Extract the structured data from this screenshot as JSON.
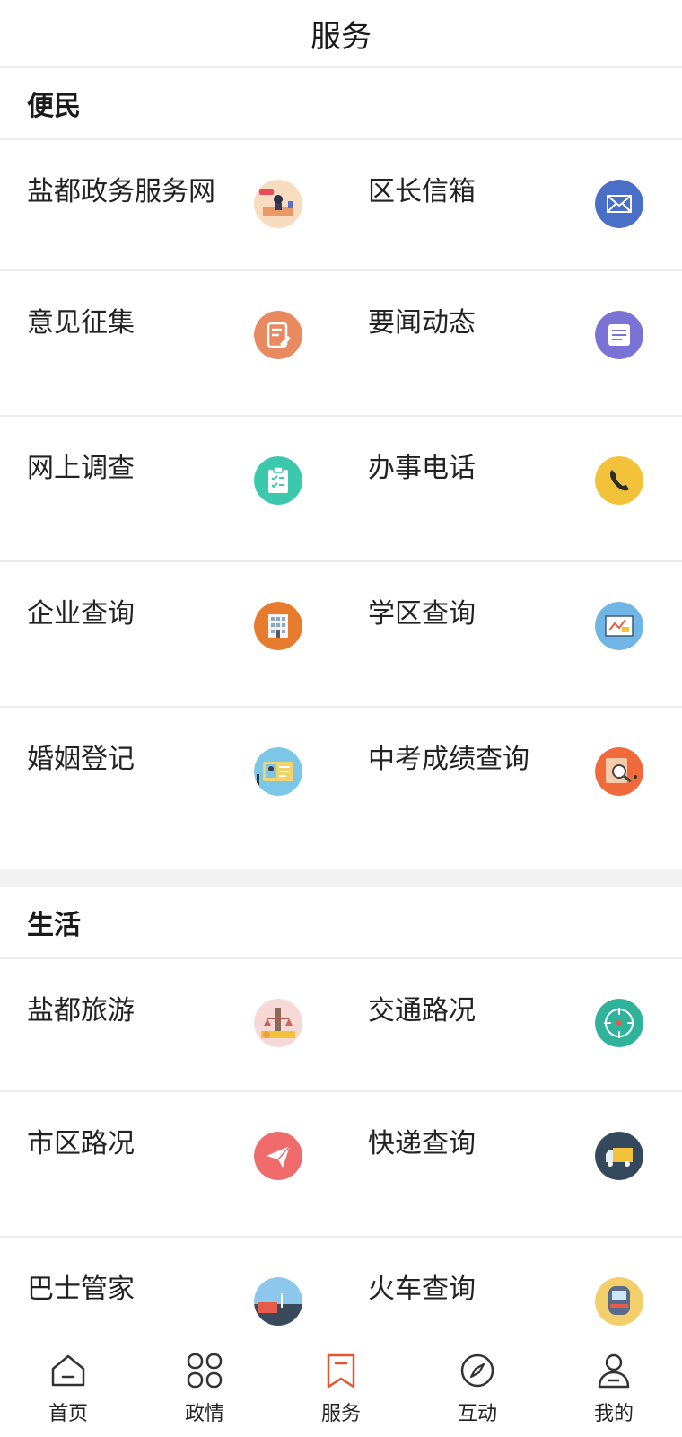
{
  "header": {
    "title": "服务"
  },
  "sections": [
    {
      "title": "便民",
      "rows": [
        [
          {
            "label": "盐都政务服务网",
            "icon": "service-desk-icon"
          },
          {
            "label": "区长信箱",
            "icon": "mail-icon"
          }
        ],
        [
          {
            "label": "意见征集",
            "icon": "edit-note-icon"
          },
          {
            "label": "要闻动态",
            "icon": "news-icon"
          }
        ],
        [
          {
            "label": "网上调查",
            "icon": "clipboard-check-icon"
          },
          {
            "label": "办事电话",
            "icon": "phone-icon"
          }
        ],
        [
          {
            "label": "企业查询",
            "icon": "building-icon"
          },
          {
            "label": "学区查询",
            "icon": "school-board-icon"
          }
        ],
        [
          {
            "label": "婚姻登记",
            "icon": "id-card-icon"
          },
          {
            "label": "中考成绩查询",
            "icon": "search-report-icon"
          }
        ]
      ]
    },
    {
      "title": "生活",
      "rows": [
        [
          {
            "label": "盐都旅游",
            "icon": "travel-icon"
          },
          {
            "label": "交通路况",
            "icon": "target-icon"
          }
        ],
        [
          {
            "label": "市区路况",
            "icon": "paper-plane-icon"
          },
          {
            "label": "快递查询",
            "icon": "truck-icon"
          }
        ],
        [
          {
            "label": "巴士管家",
            "icon": "bus-icon"
          },
          {
            "label": "火车查询",
            "icon": "train-icon"
          }
        ]
      ]
    }
  ],
  "tabbar": [
    {
      "label": "首页",
      "icon": "home-icon"
    },
    {
      "label": "政情",
      "icon": "apps-icon"
    },
    {
      "label": "服务",
      "icon": "bookmark-icon",
      "active": true
    },
    {
      "label": "互动",
      "icon": "compass-icon"
    },
    {
      "label": "我的",
      "icon": "user-icon"
    }
  ],
  "colors": {
    "accent": "#e8542b",
    "mail": "#4a6fc6",
    "edit": "#e8895f",
    "news": "#7b72d6",
    "clipboard": "#3cc8ad",
    "phone": "#f2c23a",
    "building": "#e77b2e",
    "school": "#6fb6e6",
    "idcard": "#7cc6e8",
    "report": "#f06a3b",
    "travel": "#f6d9d6",
    "target": "#2fb39b",
    "plane": "#f06b6b",
    "truck": "#34495e",
    "bus": "#8dc8ec",
    "train": "#f3cf6b"
  }
}
